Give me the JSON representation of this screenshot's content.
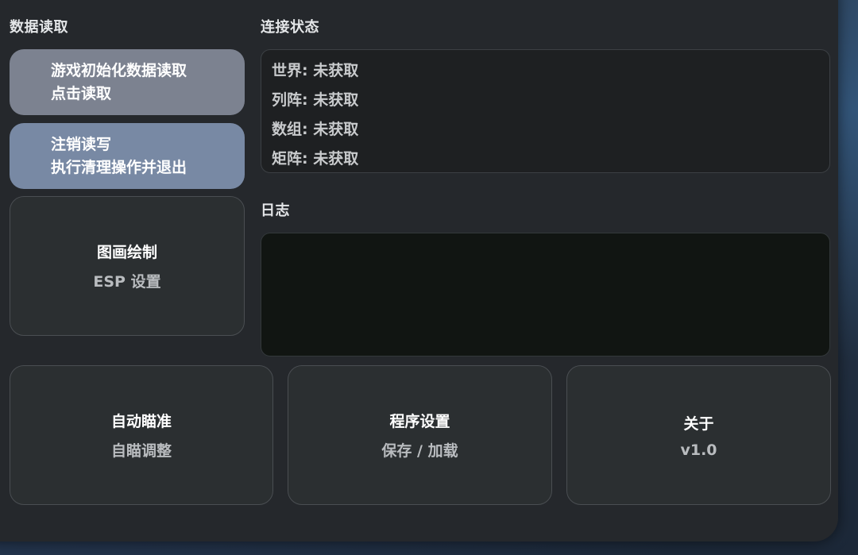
{
  "data_read": {
    "title": "数据读取",
    "load_button": {
      "line1": "游戏初始化数据读取",
      "line2": "点击读取"
    },
    "logout_button": {
      "line1": "注销读写",
      "line2": "执行清理操作并退出"
    },
    "esp_tile": {
      "title": "图画绘制",
      "subtitle": "ESP 设置"
    }
  },
  "connection": {
    "title": "连接状态",
    "rows": [
      {
        "label": "世界",
        "value": "未获取"
      },
      {
        "label": "列阵",
        "value": "未获取"
      },
      {
        "label": "数组",
        "value": "未获取"
      },
      {
        "label": "矩阵",
        "value": "未获取"
      }
    ]
  },
  "log": {
    "title": "日志",
    "content": ""
  },
  "tiles": {
    "aimbot": {
      "title": "自动瞄准",
      "subtitle": "自瞄调整"
    },
    "settings": {
      "title": "程序设置",
      "subtitle": "保存 / 加载"
    },
    "about": {
      "title": "关于",
      "subtitle": "v1.0"
    }
  },
  "colors": {
    "panel_bg": "#25282c",
    "load_button_bg": "#7c8290",
    "logout_button_bg": "#7889a4",
    "tile_bg": "#2b2f31",
    "log_bg": "#111512"
  }
}
